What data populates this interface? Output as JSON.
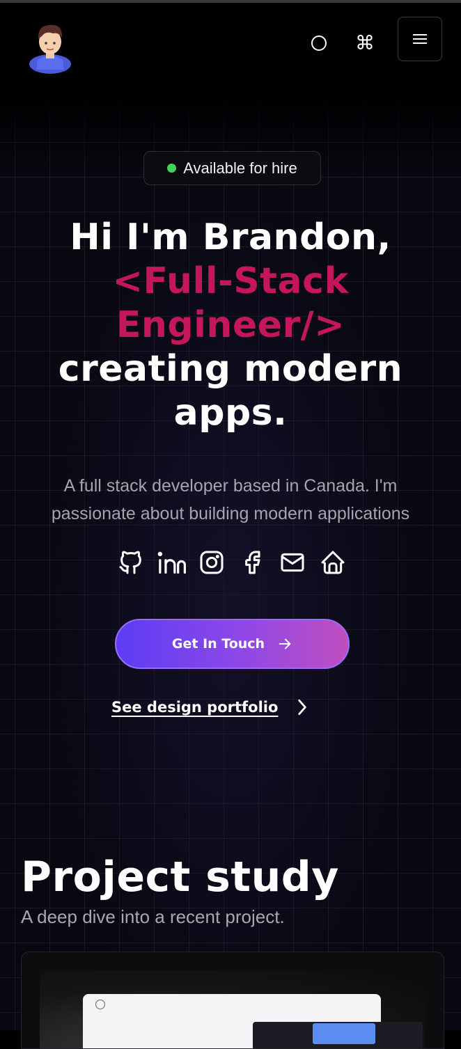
{
  "header": {
    "logo_alt": "avatar",
    "icons": [
      "circle-icon",
      "command-icon",
      "hamburger-menu-icon"
    ],
    "command_glyph": "⌘"
  },
  "hero": {
    "availability": "Available for hire",
    "headline_line1": "Hi I'm Brandon,",
    "headline_accent": "<Full-Stack Engineer/>",
    "headline_line3": "creating modern apps.",
    "description": "A full stack developer based in Canada. I'm passionate about building modern applications",
    "socials": [
      "github-icon",
      "linkedin-icon",
      "instagram-icon",
      "facebook-icon",
      "mail-icon",
      "home-icon"
    ],
    "cta_label": "Get In Touch",
    "portfolio_label": "See design portfolio"
  },
  "project_section": {
    "title": "Project study",
    "subtitle": "A deep dive into a recent project."
  },
  "colors": {
    "accent": "#c4175a",
    "status_dot": "#43d35b",
    "cta_start": "#5c3df5",
    "cta_end": "#c04fbf"
  }
}
